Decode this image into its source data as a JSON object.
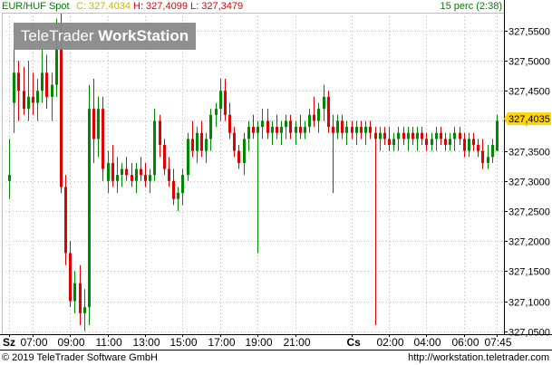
{
  "header": {
    "symbol": "EUR/HUF Spot",
    "close": "C: 327,4034",
    "high": "H: 327,4099",
    "low": "L: 327,3479",
    "period": "15 perc (2:38)"
  },
  "watermark": {
    "brand": "TeleTrader",
    "product": "WorkStation"
  },
  "footer": {
    "copyright": "© 2019 TeleTrader Software GmbH",
    "url": "http://workstation.teletrader.com"
  },
  "colors": {
    "up": "#008800",
    "down": "#e00000",
    "grid": "#b8b8b8",
    "price_tag": "#ffd600",
    "axis": "#000000"
  },
  "chart_data": {
    "type": "candlestick",
    "current_price_label": "327,4035",
    "current_price": 327.4035,
    "ylim": [
      327.045,
      327.58
    ],
    "y_ticks": [
      327.05,
      327.1,
      327.15,
      327.2,
      327.25,
      327.3,
      327.35,
      327.4,
      327.45,
      327.5,
      327.55
    ],
    "y_tick_labels": [
      "327,0500",
      "327,1000",
      "327,1500",
      "327,2000",
      "327,2500",
      "327,3000",
      "327,3500",
      "327,4000",
      "327,4500",
      "327,5000",
      "327,5500"
    ],
    "x_ticks": [
      {
        "label": "Sz",
        "idx": 0,
        "bold": true
      },
      {
        "label": "07:00",
        "idx": 5
      },
      {
        "label": "09:00",
        "idx": 13
      },
      {
        "label": "11:00",
        "idx": 21
      },
      {
        "label": "13:00",
        "idx": 29
      },
      {
        "label": "15:00",
        "idx": 37
      },
      {
        "label": "17:00",
        "idx": 45
      },
      {
        "label": "19:00",
        "idx": 53
      },
      {
        "label": "21:00",
        "idx": 61
      },
      {
        "label": "Cs",
        "idx": 73,
        "bold": true
      },
      {
        "label": "02:00",
        "idx": 81
      },
      {
        "label": "04:00",
        "idx": 89
      },
      {
        "label": "06:00",
        "idx": 97
      },
      {
        "label": "07:45",
        "idx": 104
      }
    ],
    "candles": [
      {
        "o": 327.3,
        "h": 327.37,
        "l": 327.27,
        "c": 327.31
      },
      {
        "o": 327.43,
        "h": 327.52,
        "l": 327.38,
        "c": 327.48
      },
      {
        "o": 327.48,
        "h": 327.5,
        "l": 327.4,
        "c": 327.45
      },
      {
        "o": 327.45,
        "h": 327.49,
        "l": 327.41,
        "c": 327.42
      },
      {
        "o": 327.42,
        "h": 327.5,
        "l": 327.4,
        "c": 327.44
      },
      {
        "o": 327.44,
        "h": 327.48,
        "l": 327.41,
        "c": 327.43
      },
      {
        "o": 327.43,
        "h": 327.47,
        "l": 327.4,
        "c": 327.45
      },
      {
        "o": 327.45,
        "h": 327.52,
        "l": 327.43,
        "c": 327.48
      },
      {
        "o": 327.48,
        "h": 327.51,
        "l": 327.42,
        "c": 327.44
      },
      {
        "o": 327.44,
        "h": 327.48,
        "l": 327.4,
        "c": 327.46
      },
      {
        "o": 327.46,
        "h": 327.57,
        "l": 327.44,
        "c": 327.52
      },
      {
        "o": 327.52,
        "h": 327.58,
        "l": 327.28,
        "c": 327.29
      },
      {
        "o": 327.29,
        "h": 327.31,
        "l": 327.16,
        "c": 327.18
      },
      {
        "o": 327.18,
        "h": 327.2,
        "l": 327.09,
        "c": 327.1
      },
      {
        "o": 327.1,
        "h": 327.15,
        "l": 327.08,
        "c": 327.13
      },
      {
        "o": 327.13,
        "h": 327.16,
        "l": 327.06,
        "c": 327.08
      },
      {
        "o": 327.08,
        "h": 327.12,
        "l": 327.05,
        "c": 327.09
      },
      {
        "o": 327.09,
        "h": 327.46,
        "l": 327.06,
        "c": 327.42
      },
      {
        "o": 327.42,
        "h": 327.47,
        "l": 327.33,
        "c": 327.37
      },
      {
        "o": 327.37,
        "h": 327.44,
        "l": 327.34,
        "c": 327.42
      },
      {
        "o": 327.42,
        "h": 327.44,
        "l": 327.3,
        "c": 327.32
      },
      {
        "o": 327.3,
        "h": 327.35,
        "l": 327.28,
        "c": 327.33
      },
      {
        "o": 327.33,
        "h": 327.36,
        "l": 327.29,
        "c": 327.3
      },
      {
        "o": 327.3,
        "h": 327.34,
        "l": 327.28,
        "c": 327.31
      },
      {
        "o": 327.31,
        "h": 327.33,
        "l": 327.29,
        "c": 327.32
      },
      {
        "o": 327.32,
        "h": 327.34,
        "l": 327.3,
        "c": 327.31
      },
      {
        "o": 327.31,
        "h": 327.33,
        "l": 327.29,
        "c": 327.3
      },
      {
        "o": 327.3,
        "h": 327.33,
        "l": 327.28,
        "c": 327.32
      },
      {
        "o": 327.32,
        "h": 327.34,
        "l": 327.3,
        "c": 327.31
      },
      {
        "o": 327.31,
        "h": 327.33,
        "l": 327.29,
        "c": 327.3
      },
      {
        "o": 327.3,
        "h": 327.32,
        "l": 327.28,
        "c": 327.31
      },
      {
        "o": 327.31,
        "h": 327.42,
        "l": 327.3,
        "c": 327.4
      },
      {
        "o": 327.4,
        "h": 327.41,
        "l": 327.34,
        "c": 327.36
      },
      {
        "o": 327.36,
        "h": 327.37,
        "l": 327.31,
        "c": 327.32
      },
      {
        "o": 327.32,
        "h": 327.34,
        "l": 327.29,
        "c": 327.3
      },
      {
        "o": 327.3,
        "h": 327.32,
        "l": 327.26,
        "c": 327.27
      },
      {
        "o": 327.27,
        "h": 327.29,
        "l": 327.25,
        "c": 327.28
      },
      {
        "o": 327.28,
        "h": 327.32,
        "l": 327.26,
        "c": 327.31
      },
      {
        "o": 327.31,
        "h": 327.38,
        "l": 327.3,
        "c": 327.37
      },
      {
        "o": 327.37,
        "h": 327.4,
        "l": 327.34,
        "c": 327.35
      },
      {
        "o": 327.35,
        "h": 327.39,
        "l": 327.33,
        "c": 327.38
      },
      {
        "o": 327.38,
        "h": 327.4,
        "l": 327.34,
        "c": 327.35
      },
      {
        "o": 327.35,
        "h": 327.38,
        "l": 327.33,
        "c": 327.37
      },
      {
        "o": 327.37,
        "h": 327.42,
        "l": 327.35,
        "c": 327.41
      },
      {
        "o": 327.41,
        "h": 327.43,
        "l": 327.39,
        "c": 327.42
      },
      {
        "o": 327.42,
        "h": 327.47,
        "l": 327.4,
        "c": 327.45
      },
      {
        "o": 327.45,
        "h": 327.47,
        "l": 327.4,
        "c": 327.41
      },
      {
        "o": 327.41,
        "h": 327.43,
        "l": 327.37,
        "c": 327.38
      },
      {
        "o": 327.38,
        "h": 327.39,
        "l": 327.34,
        "c": 327.35
      },
      {
        "o": 327.35,
        "h": 327.36,
        "l": 327.32,
        "c": 327.33
      },
      {
        "o": 327.33,
        "h": 327.38,
        "l": 327.31,
        "c": 327.37
      },
      {
        "o": 327.37,
        "h": 327.4,
        "l": 327.35,
        "c": 327.39
      },
      {
        "o": 327.39,
        "h": 327.41,
        "l": 327.37,
        "c": 327.38
      },
      {
        "o": 327.38,
        "h": 327.4,
        "l": 327.18,
        "c": 327.39
      },
      {
        "o": 327.39,
        "h": 327.42,
        "l": 327.37,
        "c": 327.4
      },
      {
        "o": 327.4,
        "h": 327.42,
        "l": 327.37,
        "c": 327.38
      },
      {
        "o": 327.38,
        "h": 327.4,
        "l": 327.36,
        "c": 327.39
      },
      {
        "o": 327.39,
        "h": 327.41,
        "l": 327.37,
        "c": 327.38
      },
      {
        "o": 327.38,
        "h": 327.4,
        "l": 327.36,
        "c": 327.39
      },
      {
        "o": 327.39,
        "h": 327.41,
        "l": 327.37,
        "c": 327.4
      },
      {
        "o": 327.4,
        "h": 327.41,
        "l": 327.37,
        "c": 327.38
      },
      {
        "o": 327.38,
        "h": 327.4,
        "l": 327.36,
        "c": 327.39
      },
      {
        "o": 327.39,
        "h": 327.41,
        "l": 327.37,
        "c": 327.38
      },
      {
        "o": 327.38,
        "h": 327.4,
        "l": 327.37,
        "c": 327.39
      },
      {
        "o": 327.39,
        "h": 327.42,
        "l": 327.38,
        "c": 327.41
      },
      {
        "o": 327.41,
        "h": 327.44,
        "l": 327.39,
        "c": 327.4
      },
      {
        "o": 327.4,
        "h": 327.43,
        "l": 327.38,
        "c": 327.42
      },
      {
        "o": 327.42,
        "h": 327.46,
        "l": 327.4,
        "c": 327.44
      },
      {
        "o": 327.44,
        "h": 327.45,
        "l": 327.38,
        "c": 327.39
      },
      {
        "o": 327.39,
        "h": 327.41,
        "l": 327.28,
        "c": 327.38
      },
      {
        "o": 327.38,
        "h": 327.41,
        "l": 327.37,
        "c": 327.4
      },
      {
        "o": 327.4,
        "h": 327.41,
        "l": 327.37,
        "c": 327.38
      },
      {
        "o": 327.38,
        "h": 327.4,
        "l": 327.36,
        "c": 327.39
      },
      {
        "o": 327.39,
        "h": 327.4,
        "l": 327.37,
        "c": 327.38
      },
      {
        "o": 327.38,
        "h": 327.4,
        "l": 327.36,
        "c": 327.39
      },
      {
        "o": 327.39,
        "h": 327.4,
        "l": 327.37,
        "c": 327.38
      },
      {
        "o": 327.38,
        "h": 327.4,
        "l": 327.36,
        "c": 327.39
      },
      {
        "o": 327.39,
        "h": 327.4,
        "l": 327.37,
        "c": 327.38
      },
      {
        "o": 327.38,
        "h": 327.39,
        "l": 327.06,
        "c": 327.37
      },
      {
        "o": 327.37,
        "h": 327.39,
        "l": 327.35,
        "c": 327.38
      },
      {
        "o": 327.38,
        "h": 327.39,
        "l": 327.36,
        "c": 327.37
      },
      {
        "o": 327.37,
        "h": 327.39,
        "l": 327.35,
        "c": 327.36
      },
      {
        "o": 327.36,
        "h": 327.38,
        "l": 327.35,
        "c": 327.37
      },
      {
        "o": 327.37,
        "h": 327.39,
        "l": 327.35,
        "c": 327.38
      },
      {
        "o": 327.38,
        "h": 327.39,
        "l": 327.36,
        "c": 327.37
      },
      {
        "o": 327.37,
        "h": 327.39,
        "l": 327.35,
        "c": 327.38
      },
      {
        "o": 327.38,
        "h": 327.39,
        "l": 327.36,
        "c": 327.37
      },
      {
        "o": 327.37,
        "h": 327.39,
        "l": 327.35,
        "c": 327.38
      },
      {
        "o": 327.38,
        "h": 327.39,
        "l": 327.36,
        "c": 327.37
      },
      {
        "o": 327.37,
        "h": 327.38,
        "l": 327.35,
        "c": 327.36
      },
      {
        "o": 327.36,
        "h": 327.38,
        "l": 327.35,
        "c": 327.37
      },
      {
        "o": 327.37,
        "h": 327.39,
        "l": 327.35,
        "c": 327.38
      },
      {
        "o": 327.38,
        "h": 327.39,
        "l": 327.36,
        "c": 327.37
      },
      {
        "o": 327.37,
        "h": 327.38,
        "l": 327.35,
        "c": 327.36
      },
      {
        "o": 327.36,
        "h": 327.38,
        "l": 327.35,
        "c": 327.37
      },
      {
        "o": 327.37,
        "h": 327.39,
        "l": 327.35,
        "c": 327.38
      },
      {
        "o": 327.38,
        "h": 327.39,
        "l": 327.36,
        "c": 327.37
      },
      {
        "o": 327.37,
        "h": 327.38,
        "l": 327.34,
        "c": 327.35
      },
      {
        "o": 327.35,
        "h": 327.38,
        "l": 327.34,
        "c": 327.37
      },
      {
        "o": 327.37,
        "h": 327.38,
        "l": 327.35,
        "c": 327.36
      },
      {
        "o": 327.36,
        "h": 327.37,
        "l": 327.34,
        "c": 327.35
      },
      {
        "o": 327.35,
        "h": 327.37,
        "l": 327.32,
        "c": 327.33
      },
      {
        "o": 327.33,
        "h": 327.36,
        "l": 327.32,
        "c": 327.34
      },
      {
        "o": 327.34,
        "h": 327.37,
        "l": 327.33,
        "c": 327.36
      },
      {
        "o": 327.35,
        "h": 327.41,
        "l": 327.35,
        "c": 327.4
      }
    ]
  }
}
